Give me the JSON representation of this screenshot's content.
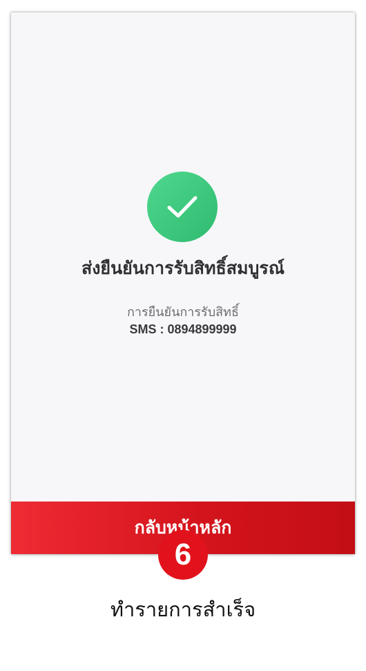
{
  "screen": {
    "status_icon": "check-icon",
    "title": "ส่งยืนยันการรับสิทธิ์สมบูรณ์",
    "subtitle": "การยืนยันการรับสิทธิ์",
    "sms_line": "SMS : 0894899999",
    "home_button_label": "กลับหน้าหลัก"
  },
  "annotation": {
    "step_number": "6",
    "caption": "ทำรายการสำเร็จ"
  },
  "colors": {
    "success_green": "#3cc97e",
    "button_red": "#e0161e",
    "badge_red": "#e2121c",
    "background": "#f7f7f9"
  }
}
